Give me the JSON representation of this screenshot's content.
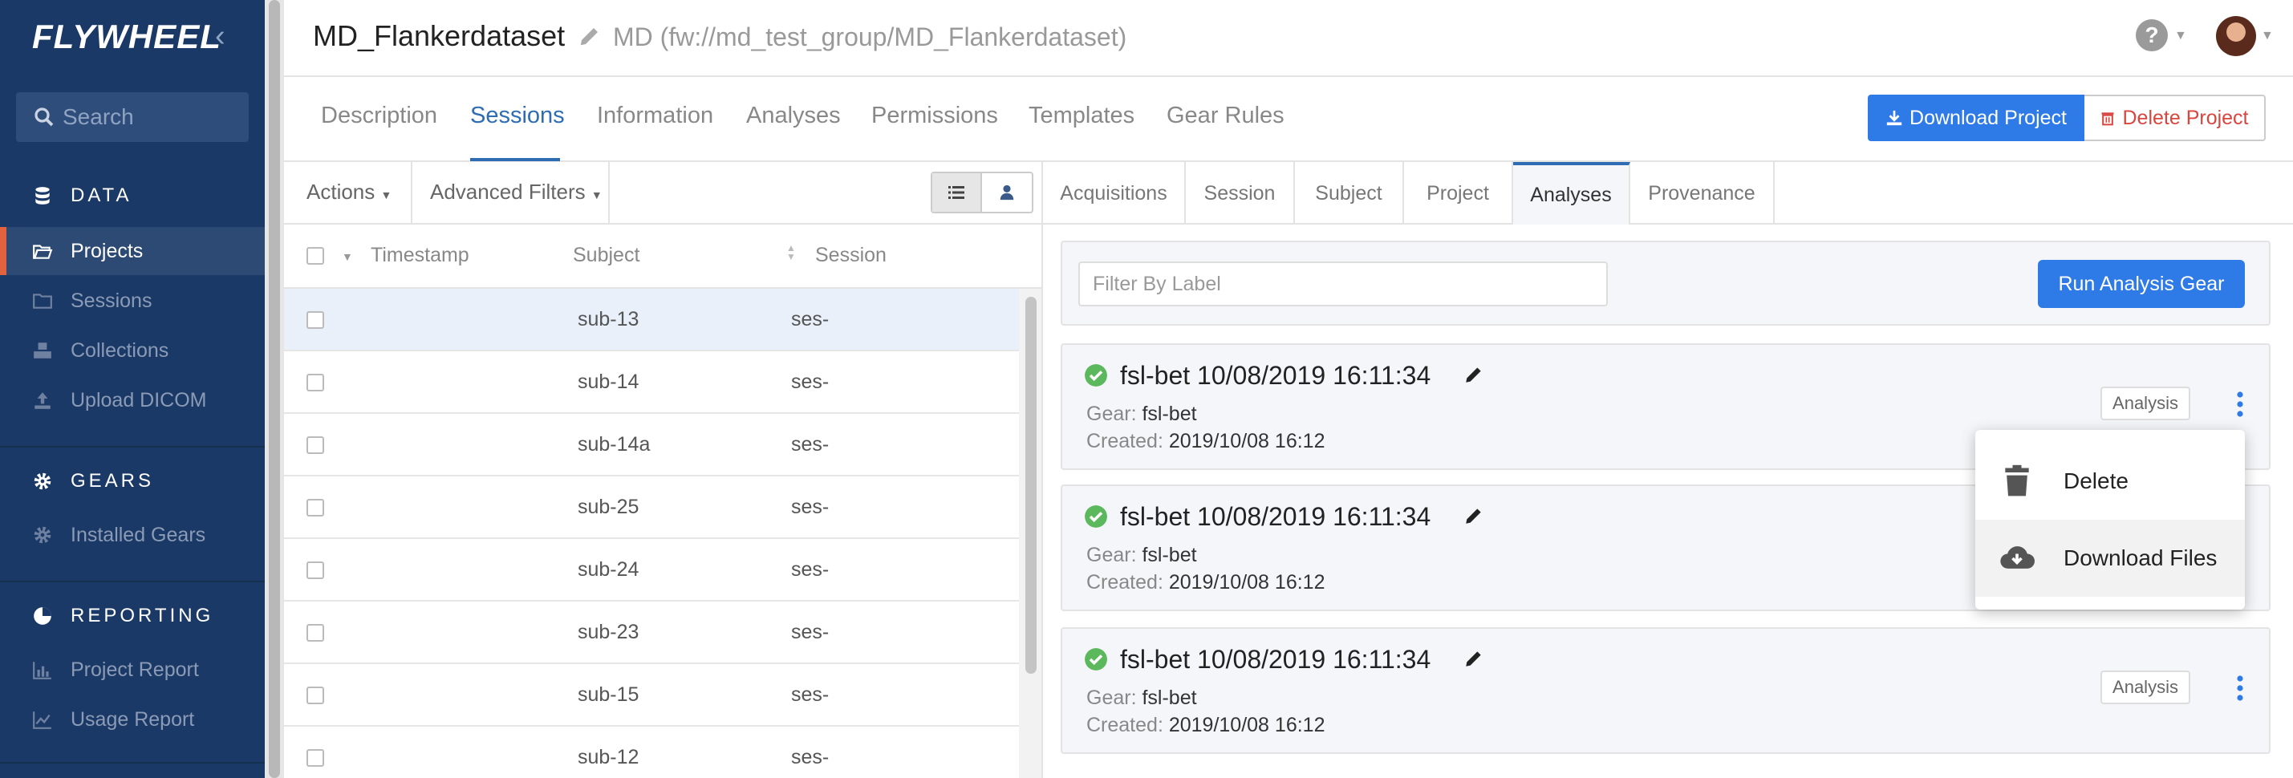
{
  "sidebar": {
    "logo": "FLYWHEEL",
    "search_placeholder": "Search",
    "sections": [
      {
        "label": "DATA",
        "items": [
          "Projects",
          "Sessions",
          "Collections",
          "Upload DICOM"
        ]
      },
      {
        "label": "GEARS",
        "items": [
          "Installed Gears"
        ]
      },
      {
        "label": "REPORTING",
        "items": [
          "Project Report",
          "Usage Report"
        ]
      }
    ],
    "active_item": "Projects"
  },
  "header": {
    "title": "MD_Flankerdataset",
    "subtitle": "MD (fw://md_test_group/MD_Flankerdataset)",
    "help": "?"
  },
  "tabs": [
    "Description",
    "Sessions",
    "Information",
    "Analyses",
    "Permissions",
    "Templates",
    "Gear Rules"
  ],
  "active_tab": "Sessions",
  "project_actions": {
    "download": "Download Project",
    "delete": "Delete Project"
  },
  "toolbar": {
    "actions": "Actions",
    "filters": "Advanced Filters"
  },
  "table": {
    "columns": [
      "Timestamp",
      "Subject",
      "Session"
    ],
    "rows": [
      {
        "subject": "sub-13",
        "session": "ses-"
      },
      {
        "subject": "sub-14",
        "session": "ses-"
      },
      {
        "subject": "sub-14a",
        "session": "ses-"
      },
      {
        "subject": "sub-25",
        "session": "ses-"
      },
      {
        "subject": "sub-24",
        "session": "ses-"
      },
      {
        "subject": "sub-23",
        "session": "ses-"
      },
      {
        "subject": "sub-15",
        "session": "ses-"
      },
      {
        "subject": "sub-12",
        "session": "ses-"
      }
    ]
  },
  "detail_tabs": [
    "Acquisitions",
    "Session",
    "Subject",
    "Project",
    "Analyses",
    "Provenance"
  ],
  "active_detail_tab": "Analyses",
  "analyses": {
    "filter_placeholder": "Filter By Label",
    "run_button": "Run Analysis Gear",
    "gear_label": "Gear:",
    "created_label": "Created:",
    "items": [
      {
        "name": "fsl-bet 10/08/2019 16:11:34",
        "gear": "fsl-bet",
        "created": "2019/10/08 16:12",
        "badge": "Analysis"
      },
      {
        "name": "fsl-bet 10/08/2019 16:11:34",
        "gear": "fsl-bet",
        "created": "2019/10/08 16:12",
        "badge": "Analysis"
      },
      {
        "name": "fsl-bet 10/08/2019 16:11:34",
        "gear": "fsl-bet",
        "created": "2019/10/08 16:12",
        "badge": "Analysis"
      }
    ]
  },
  "context_menu": {
    "delete": "Delete",
    "download": "Download Files"
  },
  "colors": {
    "sidebar": "#1b3966",
    "accent": "#2e7ae6",
    "active_marker": "#e0623e",
    "danger": "#d9453f",
    "success": "#5cb85c"
  }
}
